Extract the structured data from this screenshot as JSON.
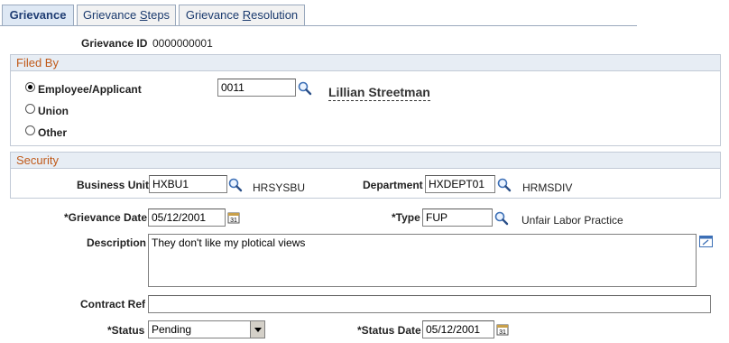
{
  "tabs": [
    {
      "label": "Grievance",
      "active": true
    },
    {
      "label_pre": "Grievance ",
      "label_ul": "S",
      "label_post": "teps"
    },
    {
      "label_pre": "Grievance ",
      "label_ul": "R",
      "label_post": "esolution"
    }
  ],
  "grievance_id": {
    "label": "Grievance ID",
    "value": "0000000001"
  },
  "filed_by": {
    "title": "Filed By",
    "options": [
      "Employee/Applicant",
      "Union",
      "Other"
    ],
    "selected": "Employee/Applicant",
    "id_value": "0011",
    "name": "Lillian Streetman"
  },
  "security": {
    "title": "Security",
    "business_unit": {
      "label": "Business Unit",
      "value": "HXBU1",
      "desc": "HRSYSBU"
    },
    "department": {
      "label": "Department",
      "value": "HXDEPT01",
      "desc": "HRMSDIV"
    }
  },
  "form": {
    "grievance_date": {
      "label": "*Grievance Date",
      "value": "05/12/2001"
    },
    "type": {
      "label": "*Type",
      "value": "FUP",
      "desc": "Unfair Labor Practice"
    },
    "description": {
      "label": "Description",
      "value": "They don't like my plotical views"
    },
    "contract_ref": {
      "label": "Contract Ref",
      "value": ""
    },
    "status": {
      "label": "*Status",
      "value": "Pending"
    },
    "status_date": {
      "label": "*Status Date",
      "value": "05/12/2001"
    }
  }
}
